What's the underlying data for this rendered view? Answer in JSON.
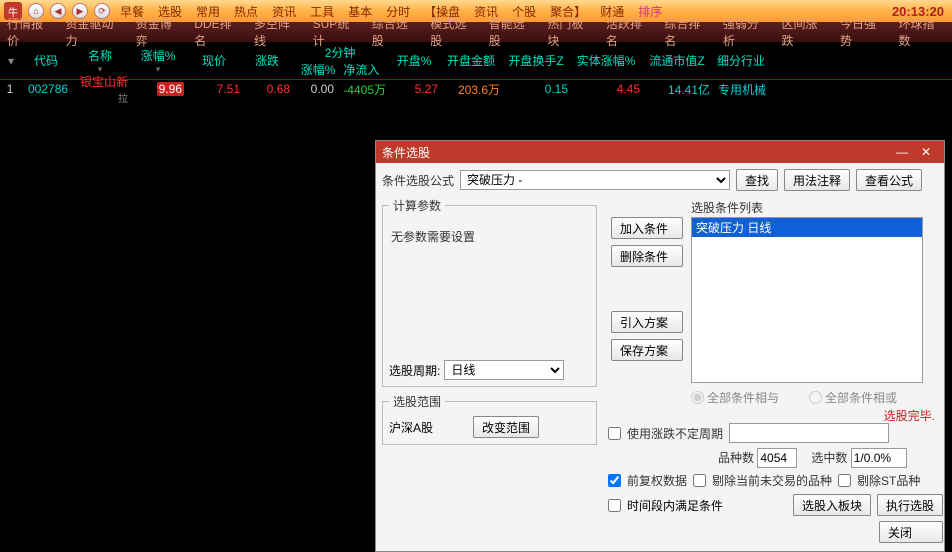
{
  "topbar": {
    "menus": [
      "早餐",
      "选股",
      "常用",
      "热点",
      "资讯",
      "工具",
      "基本",
      "分时",
      "【操盘",
      "资讯",
      "个股",
      "聚合】",
      "财通"
    ],
    "active": "排序",
    "time": "20:13:20"
  },
  "menubar2": {
    "items": [
      "行情报价",
      "资金驱动力",
      "资金博弈",
      "DDE排名",
      "多空阵线",
      "SUP统计",
      "综合选股",
      "模式选股",
      "智能选股",
      "热门板块",
      "活跃排名",
      "综合排名",
      "强弱分析",
      "区间涨跌",
      "今日强势",
      "环球指数"
    ]
  },
  "table": {
    "headers": {
      "idx": "",
      "code": "代码",
      "name": "名称",
      "pct": "涨幅%",
      "price": "现价",
      "chg": "涨跌",
      "two_min_top": "2分钟",
      "two_min_pct": "涨幅%",
      "two_min_net": "净流入",
      "open_pct": "开盘%",
      "open_amt": "开盘金额",
      "open_turn": "开盘换手Z",
      "body_pct": "实体涨幅%",
      "float_cap": "流通市值Z",
      "industry": "细分行业"
    },
    "row": {
      "idx": "1",
      "code": "002786",
      "name": "银宝山新",
      "name_tag": "拉",
      "pct": "9.96",
      "price": "7.51",
      "chg": "0.68",
      "two_pct": "0.00",
      "two_net": "-4405万",
      "open_pct": "5.27",
      "open_amt": "203.6万",
      "open_turn": "0.15",
      "body_pct": "4.45",
      "float_cap": "14.41亿",
      "industry": "专用机械"
    }
  },
  "dialog": {
    "title": "条件选股",
    "formula_label": "条件选股公式",
    "formula_value": "突破压力",
    "formula_sep": "-",
    "btn_find": "查找",
    "btn_usage": "用法注释",
    "btn_view": "查看公式",
    "params_legend": "计算参数",
    "params_text": "无参数需要设置",
    "cycle_label": "选股周期:",
    "cycle_value": "日线",
    "range_legend": "选股范围",
    "range_value": "沪深A股",
    "btn_change_range": "改变范围",
    "btn_add": "加入条件",
    "btn_del": "删除条件",
    "btn_import": "引入方案",
    "btn_save": "保存方案",
    "list_label": "选股条件列表",
    "list_item": "突破压力   日线",
    "radio_and": "全部条件相与",
    "radio_or": "全部条件相或",
    "done_msg": "选股完毕.",
    "chk_period": "使用涨跌不定周期",
    "count_label1": "品种数",
    "count_val1": "4054",
    "count_label2": "选中数",
    "count_val2": "1/0.0%",
    "chk_fq": "前复权数据",
    "chk_cull": "剔除当前未交易的品种",
    "chk_st": "剔除ST品种",
    "chk_timeslot": "时间段内满足条件",
    "btn_to_block": "选股入板块",
    "btn_exec": "执行选股",
    "btn_close": "关闭"
  }
}
